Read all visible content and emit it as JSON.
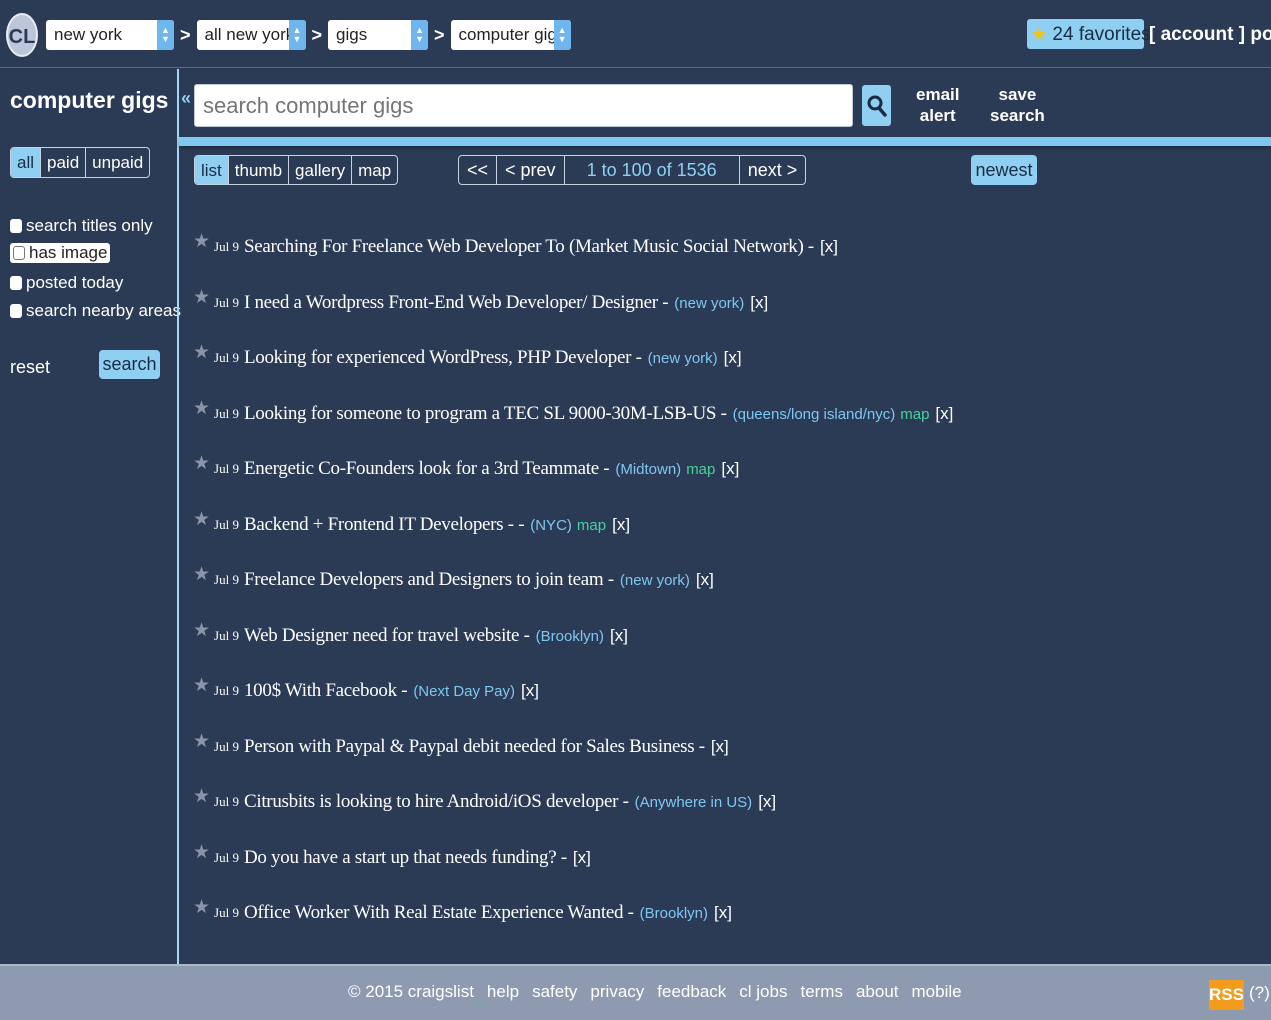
{
  "topbar": {
    "logo": "CL",
    "crumbs": [
      "new york",
      "all new york",
      "gigs",
      "computer gigs"
    ],
    "favorites": "24 favorites",
    "account": "[ account ]",
    "post": "post"
  },
  "sidebar": {
    "title": "computer gigs",
    "pay_filter": [
      "all",
      "paid",
      "unpaid"
    ],
    "pay_selected": "all",
    "checkboxes": [
      "search titles only",
      "has image",
      "posted today",
      "search nearby areas"
    ],
    "reset": "reset",
    "search_button": "search"
  },
  "search": {
    "placeholder": "search computer gigs",
    "email_alert": [
      "email",
      "alert"
    ],
    "save_search": [
      "save",
      "search"
    ]
  },
  "views": [
    "list",
    "thumb",
    "gallery",
    "map"
  ],
  "view_selected": "list",
  "pager": {
    "first": "<<",
    "prev": "< prev",
    "range": "1 to 100 of 1536",
    "next": "next >"
  },
  "sort": "newest",
  "listings": [
    {
      "date": "Jul 9",
      "title": "Searching For Freelance Web Developer To (Market Music Social Network) -",
      "loc": "",
      "map": "",
      "x": "[x]"
    },
    {
      "date": "Jul 9",
      "title": "I need a Wordpress Front-End Web Developer/ Designer -",
      "loc": "(new york)",
      "map": "",
      "x": "[x]"
    },
    {
      "date": "Jul 9",
      "title": "Looking for experienced WordPress, PHP Developer -",
      "loc": "(new york)",
      "map": "",
      "x": "[x]"
    },
    {
      "date": "Jul 9",
      "title": "Looking for someone to program a TEC SL 9000-30M-LSB-US -",
      "loc": "(queens/long island/nyc)",
      "map": "map",
      "x": "[x]"
    },
    {
      "date": "Jul 9",
      "title": "Energetic Co-Founders look for a 3rd Teammate -",
      "loc": "(Midtown)",
      "map": "map",
      "x": "[x]"
    },
    {
      "date": "Jul 9",
      "title": "Backend + Frontend IT Developers - -",
      "loc": "(NYC)",
      "map": "map",
      "x": "[x]"
    },
    {
      "date": "Jul 9",
      "title": "Freelance Developers and Designers to join team -",
      "loc": "(new york)",
      "map": "",
      "x": "[x]"
    },
    {
      "date": "Jul 9",
      "title": "Web Designer need for travel website -",
      "loc": "(Brooklyn)",
      "map": "",
      "x": "[x]"
    },
    {
      "date": "Jul 9",
      "title": "100$ With Facebook -",
      "loc": "(Next Day Pay)",
      "map": "",
      "x": "[x]"
    },
    {
      "date": "Jul 9",
      "title": "Person with Paypal & Paypal debit needed for Sales Business -",
      "loc": "",
      "map": "",
      "x": "[x]"
    },
    {
      "date": "Jul 9",
      "title": "Citrusbits is looking to hire Android/iOS developer -",
      "loc": "(Anywhere in US)",
      "map": "",
      "x": "[x]"
    },
    {
      "date": "Jul 9",
      "title": "Do you have a start up that needs funding? -",
      "loc": "",
      "map": "",
      "x": "[x]"
    },
    {
      "date": "Jul 9",
      "title": "Office Worker With Real Estate Experience Wanted -",
      "loc": "(Brooklyn)",
      "map": "",
      "x": "[x]"
    }
  ],
  "footer": {
    "links": [
      "© 2015 craigslist",
      "help",
      "safety",
      "privacy",
      "feedback",
      "cl jobs",
      "terms",
      "about",
      "mobile"
    ],
    "rss": "RSS",
    "rss_help": "(?)"
  },
  "colors": {
    "background": "#2b3a55",
    "accent": "#8fd0f2",
    "location": "#7ec8f0",
    "map_link": "#46d39a",
    "footer": "#8e9ab0"
  }
}
